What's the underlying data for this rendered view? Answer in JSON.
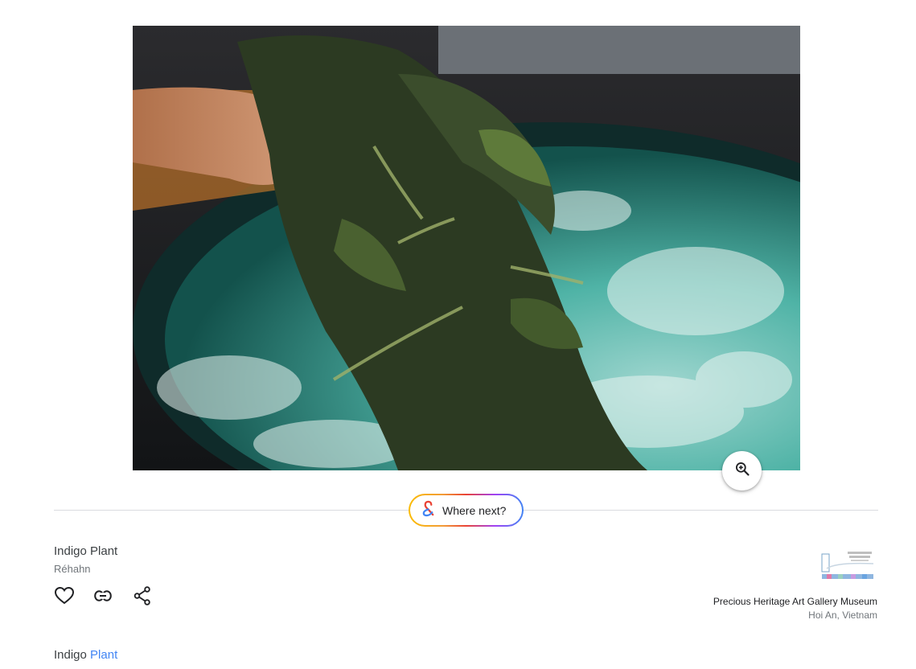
{
  "artwork": {
    "image_label": "indigo-plant-photo"
  },
  "controls": {
    "zoom_icon": "zoom-in-icon",
    "where_next_label": "Where next?",
    "where_next_icon": "ampersand-icon"
  },
  "details": {
    "title": "Indigo Plant",
    "creator": "Réhahn",
    "actions": [
      {
        "icon": "heart-icon"
      },
      {
        "icon": "link-icon"
      },
      {
        "icon": "share-icon"
      }
    ]
  },
  "partner": {
    "name": "Precious Heritage Art Gallery Museum",
    "location": "Hoi An, Vietnam"
  },
  "breadcrumb": {
    "prefix": "Indigo",
    "link": "Plant"
  },
  "colors": {
    "link": "#4285f4",
    "secondary_text": "#70757a",
    "divider": "#dadce0"
  }
}
